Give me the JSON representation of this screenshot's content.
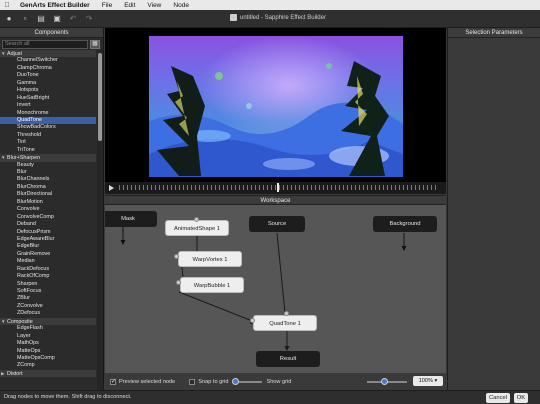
{
  "menu_bar": {
    "app_name": "GenArts Effect Builder",
    "items": [
      "File",
      "Edit",
      "View",
      "Node"
    ]
  },
  "window": {
    "title": "untitled - Sapphire Effect Builder"
  },
  "components_panel": {
    "header": "Components",
    "search_placeholder": "Search all",
    "categories": [
      {
        "name": "Adjust",
        "items": [
          "ChannelSwitcher",
          "ClampChroma",
          "DuoTone",
          "Gamma",
          "Hotspots",
          "HueSatBright",
          "Invert",
          "Monochrome",
          "QuadTone",
          "ShowBadColors",
          "Threshold",
          "Tint",
          "TriTone"
        ]
      },
      {
        "name": "Blur+Sharpen",
        "items": [
          "Beauty",
          "Blur",
          "BlurChannels",
          "BlurChroma",
          "BlurDirectional",
          "BlurMotion",
          "Convolve",
          "ConvolveComp",
          "Deband",
          "DefocusPrism",
          "EdgeAwareBlur",
          "EdgeBlur",
          "GrainRemove",
          "Median",
          "RackDefocus",
          "RackOfComp",
          "Sharpen",
          "SoftFocus",
          "ZBlur",
          "ZConvolve",
          "ZDefocus"
        ]
      },
      {
        "name": "Composite",
        "items": [
          "EdgeFlash",
          "Layer",
          "MathOps",
          "MatteOps",
          "MatteOpsComp",
          "ZComp"
        ]
      },
      {
        "name": "Distort",
        "items": []
      }
    ],
    "selected_item": "QuadTone"
  },
  "parameters_panel": {
    "header": "Selection Parameters"
  },
  "workspace": {
    "header": "Workspace",
    "nodes": {
      "mask": "Mask",
      "animated_shape": "AnimatedShape 1",
      "source": "Source",
      "background": "Background",
      "warp_vortex": "WarpVortex 1",
      "warp_bubble": "WarpBubble 1",
      "quadtone": "QuadTone 1",
      "result": "Result"
    },
    "footer": {
      "preview_label": "Preview selected node",
      "preview_checked": true,
      "snap_label": "Snap to grid",
      "snap_checked": false,
      "show_grid_label": "Show grid",
      "zoom": "100%"
    }
  },
  "status_bar": {
    "hint": "Drag nodes to move them. Shift drag to disconnect.",
    "cancel_label": "Cancel",
    "ok_label": "OK"
  },
  "colors": {
    "selection": "#3b5fa8",
    "node_dark": "#1d1d1d",
    "node_light": "#eeeeee",
    "workspace_bg": "#565656"
  }
}
